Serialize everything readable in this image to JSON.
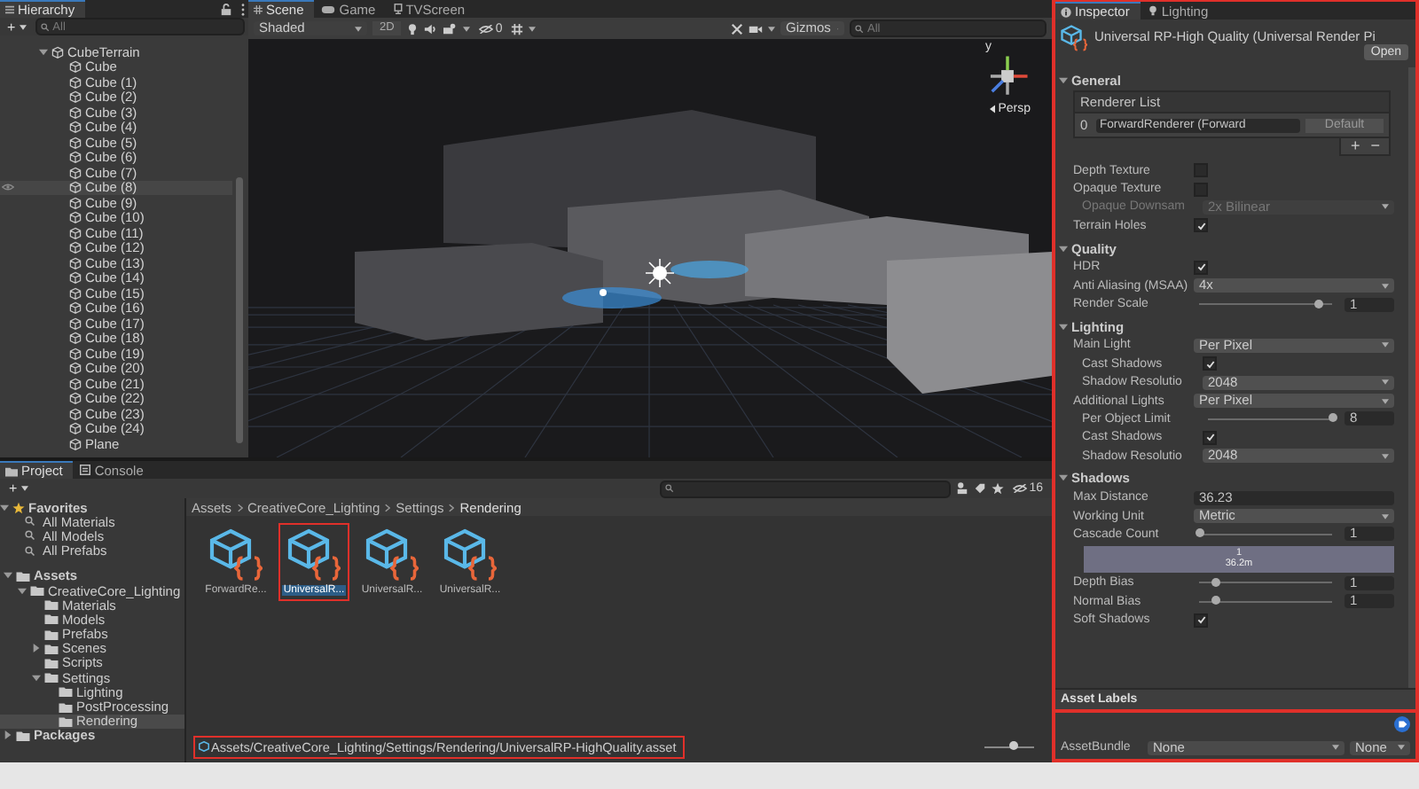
{
  "hierarchy": {
    "title": "Hierarchy",
    "add": "+",
    "search": {
      "placeholder": "All"
    },
    "items": [
      {
        "label": "CubeTerrain",
        "expanded": true,
        "selected": false,
        "children": [
          {
            "label": "Cube",
            "selected": false
          },
          {
            "label": "Cube (1)",
            "selected": false
          },
          {
            "label": "Cube (2)",
            "selected": false
          },
          {
            "label": "Cube (3)",
            "selected": false
          },
          {
            "label": "Cube (4)",
            "selected": false
          },
          {
            "label": "Cube (5)",
            "selected": false
          },
          {
            "label": "Cube (6)",
            "selected": false
          },
          {
            "label": "Cube (7)",
            "selected": false
          },
          {
            "label": "Cube (8)",
            "selected": true
          },
          {
            "label": "Cube (9)",
            "selected": false
          },
          {
            "label": "Cube (10)",
            "selected": false
          },
          {
            "label": "Cube (11)",
            "selected": false
          },
          {
            "label": "Cube (12)",
            "selected": false
          },
          {
            "label": "Cube (13)",
            "selected": false
          },
          {
            "label": "Cube (14)",
            "selected": false
          },
          {
            "label": "Cube (15)",
            "selected": false
          },
          {
            "label": "Cube (16)",
            "selected": false
          },
          {
            "label": "Cube (17)",
            "selected": false
          },
          {
            "label": "Cube (18)",
            "selected": false
          },
          {
            "label": "Cube (19)",
            "selected": false
          },
          {
            "label": "Cube (20)",
            "selected": false
          },
          {
            "label": "Cube (21)",
            "selected": false
          },
          {
            "label": "Cube (22)",
            "selected": false
          },
          {
            "label": "Cube (23)",
            "selected": false
          },
          {
            "label": "Cube (24)",
            "selected": false
          },
          {
            "label": "Plane",
            "selected": false
          }
        ]
      }
    ]
  },
  "scene": {
    "tabs": [
      {
        "label": "Scene",
        "selected": true,
        "kind": "scene"
      },
      {
        "label": "Game",
        "selected": false,
        "kind": "game"
      },
      {
        "label": "TVScreen",
        "selected": false,
        "kind": "screen"
      }
    ],
    "shading": "Shaded",
    "mode_2d": "2D",
    "hidden_count": "0",
    "gizmos": "Gizmos",
    "search": {
      "placeholder": "All"
    },
    "axis_label": "y",
    "projection": "Persp"
  },
  "project": {
    "tabs": [
      {
        "label": "Project",
        "selected": true,
        "kind": "project"
      },
      {
        "label": "Console",
        "selected": false,
        "kind": "console"
      }
    ],
    "add": "+",
    "hidden_count": "16",
    "favorites": {
      "label": "Favorites",
      "expanded": true,
      "items": [
        "All Materials",
        "All Models",
        "All Prefabs"
      ]
    },
    "tree": [
      {
        "label": "Assets",
        "expanded": true,
        "selected": false,
        "children": [
          {
            "label": "CreativeCore_Lighting",
            "expanded": true,
            "selected": false,
            "children": [
              {
                "label": "Materials",
                "selected": false
              },
              {
                "label": "Models",
                "selected": false
              },
              {
                "label": "Prefabs",
                "selected": false
              },
              {
                "label": "Scenes",
                "expanded": false,
                "selected": false
              },
              {
                "label": "Scripts",
                "selected": false
              },
              {
                "label": "Settings",
                "expanded": true,
                "selected": false,
                "children": [
                  {
                    "label": "Lighting",
                    "selected": false
                  },
                  {
                    "label": "PostProcessing",
                    "selected": false
                  },
                  {
                    "label": "Rendering",
                    "selected": true
                  }
                ]
              }
            ]
          }
        ]
      },
      {
        "label": "Packages",
        "expanded": false,
        "selected": false
      }
    ],
    "breadcrumb": [
      "Assets",
      "CreativeCore_Lighting",
      "Settings",
      "Rendering"
    ],
    "assets": [
      {
        "label": "ForwardRe...",
        "selected": false
      },
      {
        "label": "UniversalR...",
        "selected": true
      },
      {
        "label": "UniversalR...",
        "selected": false
      },
      {
        "label": "UniversalR...",
        "selected": false
      }
    ],
    "path": "Assets/CreativeCore_Lighting/Settings/Rendering/UniversalRP-HighQuality.asset",
    "zoom": {
      "level": 0.6
    }
  },
  "inspector": {
    "tabs": [
      {
        "label": "Inspector",
        "selected": true,
        "kind": "info"
      },
      {
        "label": "Lighting",
        "selected": false,
        "kind": "light"
      }
    ],
    "title": "Universal RP-High Quality (Universal Render Pi",
    "open": "Open",
    "sections": [
      {
        "title": "General",
        "expanded": true,
        "rows": [
          {
            "kind": "list",
            "title": "Renderer List",
            "index": "0",
            "value": "ForwardRenderer (Forward",
            "button": "Default",
            "add": "+",
            "remove": "−"
          },
          {
            "kind": "checkbox",
            "label": "Depth Texture",
            "checked": false
          },
          {
            "kind": "checkbox",
            "label": "Opaque Texture",
            "checked": false,
            "children": [
              {
                "kind": "dropdown",
                "label": "Opaque Downsam",
                "value": "2x Bilinear",
                "disabled": true
              }
            ]
          },
          {
            "kind": "checkbox",
            "label": "Terrain Holes",
            "checked": true
          }
        ]
      },
      {
        "title": "Quality",
        "expanded": true,
        "rows": [
          {
            "kind": "checkbox",
            "label": "HDR",
            "checked": true
          },
          {
            "kind": "dropdown",
            "label": "Anti Aliasing (MSAA)",
            "value": "4x",
            "disabled": false
          },
          {
            "kind": "slider",
            "label": "Render Scale",
            "level": 0.9,
            "value": "1"
          }
        ]
      },
      {
        "title": "Lighting",
        "expanded": true,
        "rows": [
          {
            "kind": "dropdown",
            "label": "Main Light",
            "value": "Per Pixel",
            "disabled": false,
            "children": [
              {
                "kind": "checkbox",
                "label": "Cast Shadows",
                "checked": true
              },
              {
                "kind": "dropdown",
                "label": "Shadow Resolutio",
                "value": "2048",
                "disabled": false
              }
            ]
          },
          {
            "kind": "dropdown",
            "label": "Additional Lights",
            "value": "Per Pixel",
            "disabled": false,
            "children": [
              {
                "kind": "slider",
                "label": "Per Object Limit",
                "level": 1,
                "value": "8"
              },
              {
                "kind": "checkbox",
                "label": "Cast Shadows",
                "checked": true
              },
              {
                "kind": "dropdown",
                "label": "Shadow Resolutio",
                "value": "2048",
                "disabled": false
              }
            ]
          }
        ]
      },
      {
        "title": "Shadows",
        "expanded": true,
        "rows": [
          {
            "kind": "text",
            "label": "Max Distance",
            "value": "36.23"
          },
          {
            "kind": "dropdown",
            "label": "Working Unit",
            "value": "Metric",
            "disabled": false
          },
          {
            "kind": "slider",
            "label": "Cascade Count",
            "level": 0,
            "value": "1"
          },
          {
            "kind": "cascade",
            "lines": [
              "1",
              "36.2m"
            ]
          },
          {
            "kind": "slider",
            "label": "Depth Bias",
            "level": 0.12,
            "value": "1"
          },
          {
            "kind": "slider",
            "label": "Normal Bias",
            "level": 0.12,
            "value": "1"
          },
          {
            "kind": "checkbox",
            "label": "Soft Shadows",
            "checked": true
          }
        ]
      }
    ],
    "labels_title": "Asset Labels",
    "bundle_label": "AssetBundle",
    "bundle": "None",
    "variant": "None"
  }
}
